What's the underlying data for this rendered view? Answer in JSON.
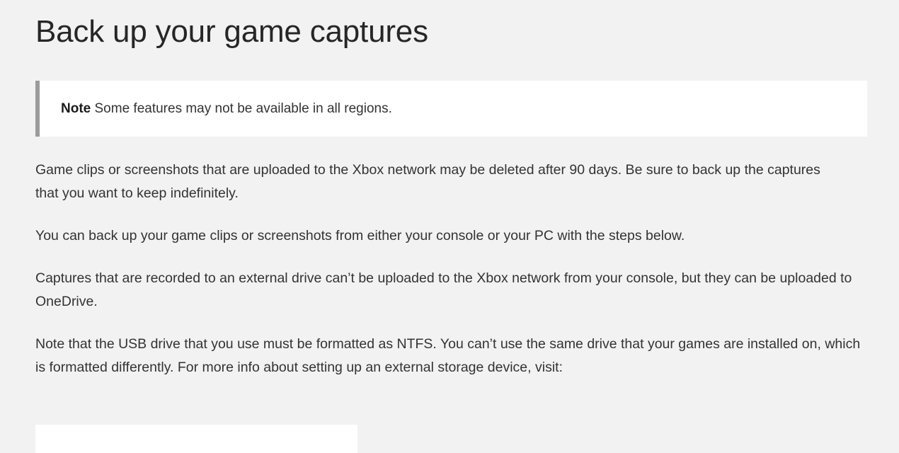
{
  "page": {
    "title": "Back up your game captures",
    "background_color": "#f2f2f2",
    "text_color": "#333333",
    "heading_color": "#262626"
  },
  "note": {
    "label": "Note",
    "text": " Some features may not be available in all regions.",
    "accent_color": "#9b9b9b",
    "background_color": "#ffffff"
  },
  "paragraphs": [
    {
      "text": "Game clips or screenshots that are uploaded to the Xbox network may be deleted after 90 days. Be sure to back up the captures that you want to keep indefinitely."
    },
    {
      "text": "You can back up your game clips or screenshots from either your console or your PC with the steps below."
    },
    {
      "text": "Captures that are recorded to an external drive can’t be uploaded to the Xbox network from your console, but they can be uploaded to OneDrive."
    },
    {
      "text": "Note that the USB drive that you use must be formatted as NTFS. You can’t use the same drive that your games are installed on, which is formatted differently. For more info about setting up an external storage device, visit:"
    }
  ]
}
